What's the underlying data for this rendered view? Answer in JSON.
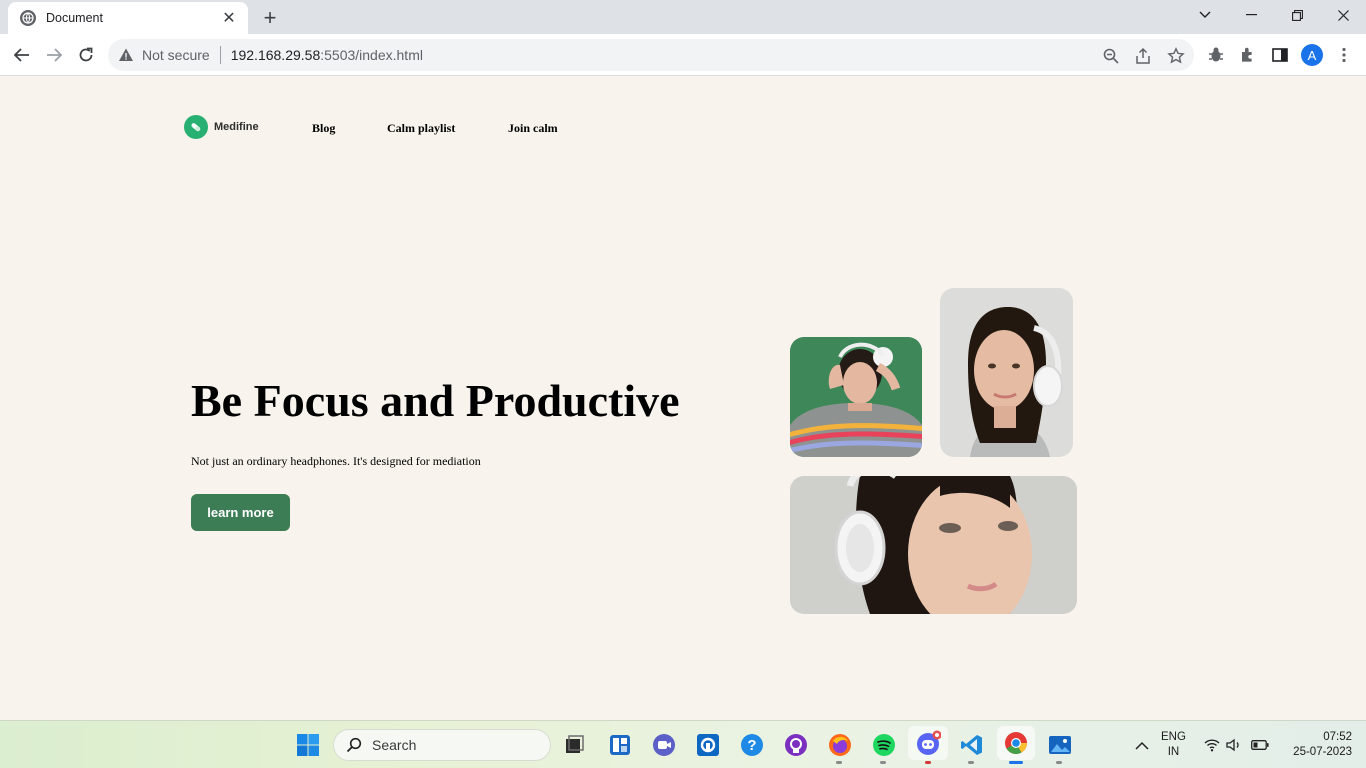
{
  "browser": {
    "tab_title": "Document",
    "security_label": "Not secure",
    "url_host": "192.168.29.58",
    "url_path": ":5503/index.html",
    "avatar_letter": "A"
  },
  "site": {
    "logo_text": "Medifine",
    "nav": [
      "Blog",
      "Calm playlist",
      "Join calm"
    ],
    "hero_title": "Be Focus and Productive",
    "hero_subtitle": "Not just an ordinary headphones. It's designed for mediation",
    "cta_label": "learn more",
    "accent_color": "#3c7d55",
    "logo_color": "#27b072",
    "background_color": "#f8f3ec"
  },
  "taskbar": {
    "search_placeholder": "Search",
    "lang_line1": "ENG",
    "lang_line2": "IN",
    "time": "07:52",
    "date": "25-07-2023",
    "apps": [
      "start-icon",
      "search-icon",
      "file-explorer-icon",
      "store-icon",
      "teams-icon",
      "app-icon",
      "help-icon",
      "github-icon",
      "firefox-icon",
      "spotify-icon",
      "discord-icon",
      "vscode-icon",
      "chrome-icon",
      "photos-icon"
    ]
  }
}
